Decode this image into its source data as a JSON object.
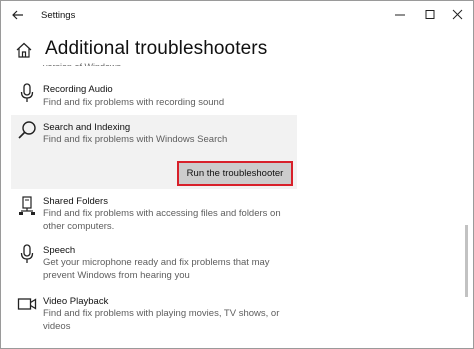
{
  "window": {
    "title": "Settings"
  },
  "page": {
    "title": "Additional troubleshooters",
    "cut_off_text": "version of Windows."
  },
  "items": [
    {
      "name": "Recording Audio",
      "description": "Find and fix problems with recording sound",
      "icon": "microphone-icon"
    },
    {
      "name": "Search and Indexing",
      "description": "Find and fix problems with Windows Search",
      "icon": "search-icon"
    },
    {
      "name": "Shared Folders",
      "description": "Find and fix problems with accessing files and folders on other computers.",
      "icon": "shared-folders-icon"
    },
    {
      "name": "Speech",
      "description": "Get your microphone ready and fix problems that may prevent Windows from hearing you",
      "icon": "microphone-icon"
    },
    {
      "name": "Video Playback",
      "description": "Find and fix problems with playing movies, TV shows, or videos",
      "icon": "video-camera-icon"
    }
  ],
  "run_button": {
    "label": "Run the troubleshooter",
    "highlight_color": "#d8202a"
  },
  "colors": {
    "selected_background": "#f2f2f2",
    "button_background": "#cccccc"
  }
}
